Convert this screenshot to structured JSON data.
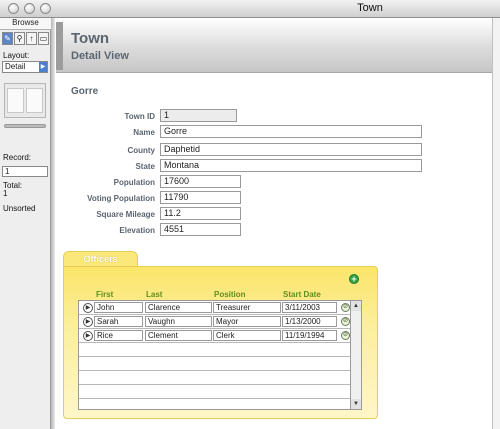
{
  "window": {
    "title": "Town"
  },
  "status_area": {
    "mode": "Browse",
    "tools": [
      "✎",
      "⚲",
      "↑",
      "▭"
    ],
    "layout_label": "Layout:",
    "layout_value": "Detail",
    "record_label": "Record:",
    "record_value": "1",
    "total_label": "Total:",
    "total_value": "1",
    "sort_status": "Unsorted"
  },
  "header": {
    "title": "Town",
    "subtitle": "Detail View"
  },
  "record_heading": "Gorre",
  "fields": [
    {
      "label": "Town ID",
      "value": "1"
    },
    {
      "label": "Name",
      "value": "Gorre"
    },
    {
      "label": "County",
      "value": "Daphetid"
    },
    {
      "label": "State",
      "value": "Montana"
    },
    {
      "label": "Population",
      "value": "17600"
    },
    {
      "label": "Voting Population",
      "value": "11790"
    },
    {
      "label": "Square Mileage",
      "value": "11.2"
    },
    {
      "label": "Elevation",
      "value": "4551"
    }
  ],
  "officers": {
    "tab_label": "Officers",
    "columns": [
      "First",
      "Last",
      "Position",
      "Start Date"
    ],
    "rows": [
      {
        "first": "John",
        "last": "Clarence",
        "position": "Treasurer",
        "start_date": "3/11/2003"
      },
      {
        "first": "Sarah",
        "last": "Vaughn",
        "position": "Mayor",
        "start_date": "1/13/2000"
      },
      {
        "first": "Rice",
        "last": "Clement",
        "position": "Clerk",
        "start_date": "11/19/1994"
      }
    ]
  },
  "icons": {
    "add": "+",
    "go": "▶",
    "delete": "⊘",
    "scroll_up": "▲",
    "scroll_down": "▼",
    "layout_arrow": "▶"
  },
  "colors": {
    "tab_yellow": "#fbe56a",
    "header_text": "#5b6570",
    "column_header": "#5f8f1f",
    "add_green": "#33a542"
  }
}
